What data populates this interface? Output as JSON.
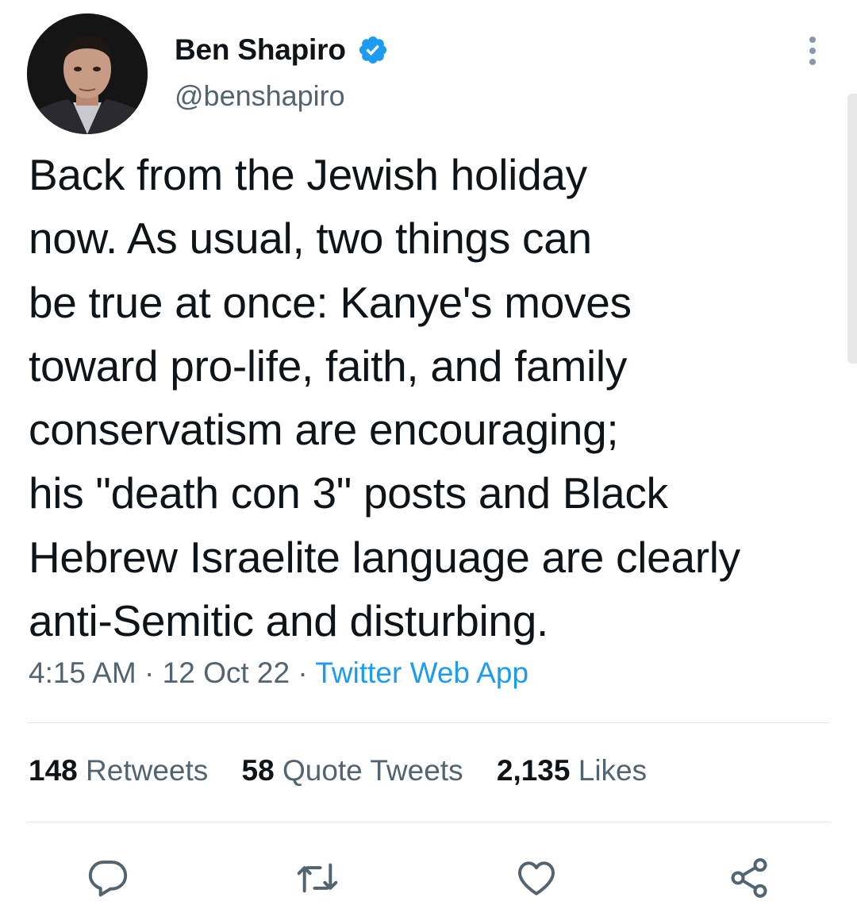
{
  "author": {
    "display_name": "Ben Shapiro",
    "handle": "@benshapiro",
    "verified": true,
    "avatar_icon": "profile-photo"
  },
  "tweet": {
    "text": "Back from the Jewish holiday\nnow. As usual, two things can\nbe true at once: Kanye's moves\ntoward pro-life, faith, and family\nconservatism are encouraging;\nhis \"death con 3\" posts and Black\nHebrew Israelite language are clearly\nanti-Semitic and disturbing.",
    "time": "4:15 AM",
    "separator": "·",
    "date": "12 Oct 22",
    "source": "Twitter Web App"
  },
  "stats": {
    "retweets": {
      "count": "148",
      "label": "Retweets"
    },
    "quote_tweets": {
      "count": "58",
      "label": "Quote Tweets"
    },
    "likes": {
      "count": "2,135",
      "label": "Likes"
    }
  },
  "actions": {
    "reply_icon": "reply-icon",
    "retweet_icon": "retweet-icon",
    "like_icon": "heart-icon",
    "share_icon": "share-icon",
    "more_icon": "more-vertical-icon"
  },
  "colors": {
    "text": "#0f1419",
    "secondary": "#536471",
    "link": "#1d9bf0",
    "verified": "#1d9bf0",
    "divider": "#e1e5e8"
  }
}
